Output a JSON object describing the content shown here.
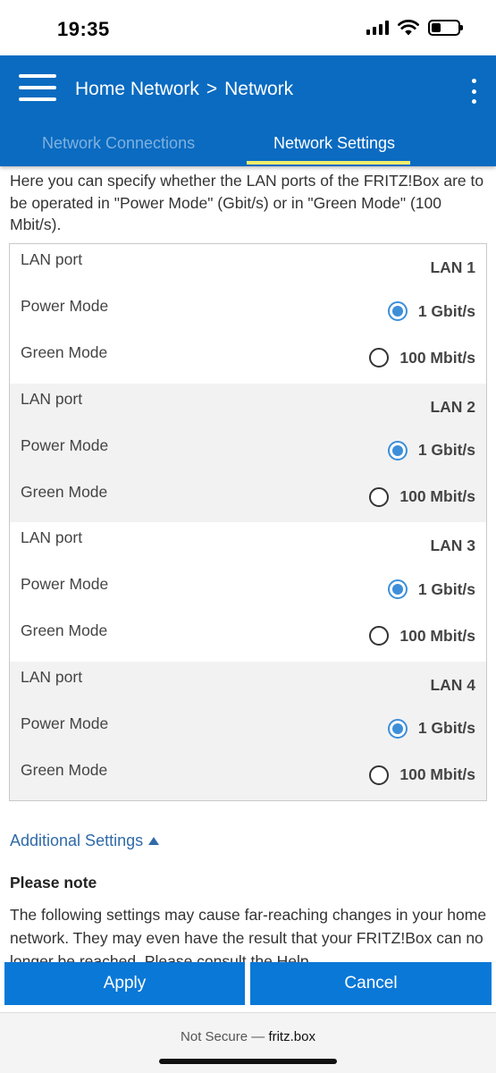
{
  "status_bar": {
    "time": "19:35"
  },
  "header": {
    "breadcrumb_parent": "Home Network",
    "breadcrumb_separator": ">",
    "breadcrumb_current": "Network",
    "tabs": [
      {
        "label": "Network Connections",
        "active": false
      },
      {
        "label": "Network Settings",
        "active": true
      }
    ],
    "accent_color": "#0a6bc1",
    "tab_indicator_color": "#f3ec6b"
  },
  "intro": "Here you can specify whether the LAN ports of the FRITZ!Box are to be operated in \"Power Mode\" (Gbit/s) or in \"Green Mode\" (100 Mbit/s).",
  "lan_ports": [
    {
      "port_label": "LAN port",
      "port": "LAN 1",
      "power_label": "Power Mode",
      "power_value": "1 Gbit/s",
      "green_label": "Green Mode",
      "green_value": "100 Mbit/s",
      "selected": "power"
    },
    {
      "port_label": "LAN port",
      "port": "LAN 2",
      "power_label": "Power Mode",
      "power_value": "1 Gbit/s",
      "green_label": "Green Mode",
      "green_value": "100 Mbit/s",
      "selected": "power"
    },
    {
      "port_label": "LAN port",
      "port": "LAN 3",
      "power_label": "Power Mode",
      "power_value": "1 Gbit/s",
      "green_label": "Green Mode",
      "green_value": "100 Mbit/s",
      "selected": "power"
    },
    {
      "port_label": "LAN port",
      "port": "LAN 4",
      "power_label": "Power Mode",
      "power_value": "1 Gbit/s",
      "green_label": "Green Mode",
      "green_value": "100 Mbit/s",
      "selected": "power"
    }
  ],
  "additional_settings": "Additional Settings",
  "note": {
    "title": "Please note",
    "text": "The following settings may cause far-reaching changes in your home network. They may even have the result that your FRITZ!Box can no longer be reached. Please consult the Help."
  },
  "buttons": {
    "apply": "Apply",
    "cancel": "Cancel"
  },
  "browser": {
    "security": "Not Secure —",
    "domain": "fritz.box"
  }
}
